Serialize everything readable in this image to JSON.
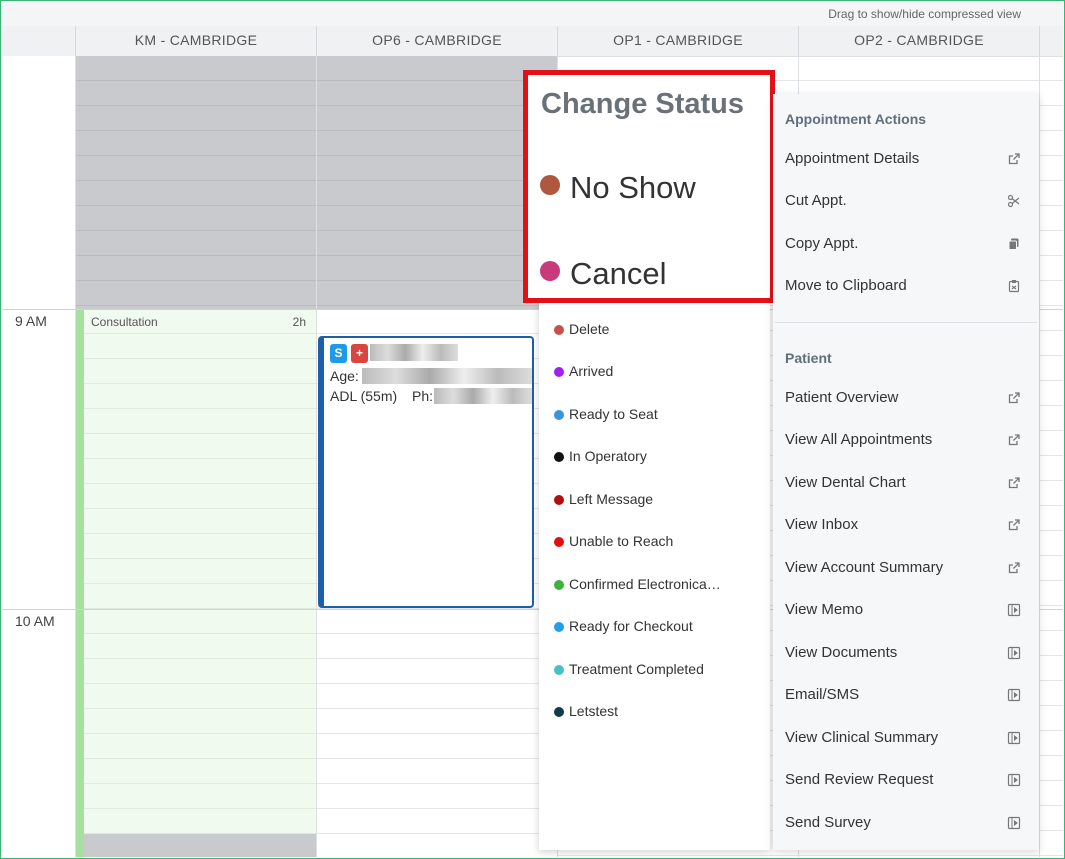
{
  "header": {
    "drag_hint": "Drag to show/hide compressed view"
  },
  "columns": [
    "KM - CAMBRIDGE",
    "OP6 - CAMBRIDGE",
    "OP1 - CAMBRIDGE",
    "OP2 - CAMBRIDGE"
  ],
  "time_labels": [
    "9 AM",
    "10 AM"
  ],
  "consultation": {
    "label": "Consultation",
    "duration": "2h"
  },
  "appointment": {
    "badges": [
      "S",
      "+"
    ],
    "age_label": "Age:",
    "procedure": "ADL (55m)",
    "phone_label": "Ph:"
  },
  "highlight": {
    "title": "Change Status",
    "items": [
      {
        "label": "No Show",
        "color": "#b0573f"
      },
      {
        "label": "Cancel",
        "color": "#c93a7a"
      }
    ]
  },
  "status_menu": {
    "items": [
      {
        "label": "Delete",
        "color": "#c9504a"
      },
      {
        "label": "Arrived",
        "color": "#a020f0"
      },
      {
        "label": "Ready to Seat",
        "color": "#3a94d8"
      },
      {
        "label": "In Operatory",
        "color": "#111111"
      },
      {
        "label": "Left Message",
        "color": "#b01010"
      },
      {
        "label": "Unable to Reach",
        "color": "#e01010"
      },
      {
        "label": "Confirmed Electronica…",
        "color": "#3cb43c"
      },
      {
        "label": "Ready for Checkout",
        "color": "#1fa0e8"
      },
      {
        "label": "Treatment Completed",
        "color": "#48c0c8"
      },
      {
        "label": "Letstest",
        "color": "#123a4a"
      }
    ]
  },
  "actions_menu": {
    "appointment_title": "Appointment Actions",
    "appointment_items": [
      {
        "label": "Appointment Details",
        "icon": "external-link-icon"
      },
      {
        "label": "Cut Appt.",
        "icon": "scissors-icon"
      },
      {
        "label": "Copy Appt.",
        "icon": "copy-icon"
      },
      {
        "label": "Move to Clipboard",
        "icon": "clipboard-icon"
      }
    ],
    "patient_title": "Patient",
    "patient_items": [
      {
        "label": "Patient Overview",
        "icon": "external-link-icon"
      },
      {
        "label": "View All Appointments",
        "icon": "external-link-icon"
      },
      {
        "label": "View Dental Chart",
        "icon": "external-link-icon"
      },
      {
        "label": "View Inbox",
        "icon": "external-link-icon"
      },
      {
        "label": "View Account Summary",
        "icon": "external-link-icon"
      },
      {
        "label": "View Memo",
        "icon": "panel-icon"
      },
      {
        "label": "View Documents",
        "icon": "panel-icon"
      },
      {
        "label": "Email/SMS",
        "icon": "panel-icon"
      },
      {
        "label": "View Clinical Summary",
        "icon": "panel-icon"
      },
      {
        "label": "Send Review Request",
        "icon": "panel-icon"
      },
      {
        "label": "Send Survey",
        "icon": "panel-icon"
      }
    ]
  }
}
